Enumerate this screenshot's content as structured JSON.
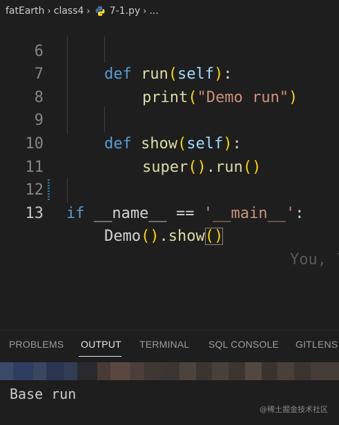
{
  "breadcrumb": {
    "folder1": "fatEarth",
    "folder2": "class4",
    "file": "7-1.py",
    "more": "..."
  },
  "editor": {
    "line_numbers": [
      "6",
      "7",
      "8",
      "9",
      "10",
      "11",
      "12",
      "13"
    ],
    "active_line": "13",
    "tokens": {
      "def1": "def",
      "run": "run",
      "self1": "self",
      "colon1": ":",
      "print": "print",
      "demo_run_str": "\"Demo run\"",
      "def2": "def",
      "show": "show",
      "self2": "self",
      "colon2": ":",
      "super": "super",
      "dot_run": ".",
      "run2": "run",
      "if": "if",
      "name": "__name__",
      "eq": "==",
      "main_str": "'__main__'",
      "colon3": ":",
      "demo": "Demo",
      "dot_show": ".",
      "show2": "show"
    },
    "blame_text": "You, ?"
  },
  "panel": {
    "tabs": [
      "PROBLEMS",
      "OUTPUT",
      "TERMINAL",
      "SQL CONSOLE",
      "GITLENS"
    ],
    "active_tab": "OUTPUT",
    "output": "Base run"
  },
  "watermark": "@稀土掘金技术社区",
  "colors": {
    "background": "#1e1e1e",
    "keyword": "#569cd6",
    "function": "#dcdcaa",
    "string": "#ce9178",
    "bracket": "#ffd700",
    "control": "#c586c0"
  }
}
